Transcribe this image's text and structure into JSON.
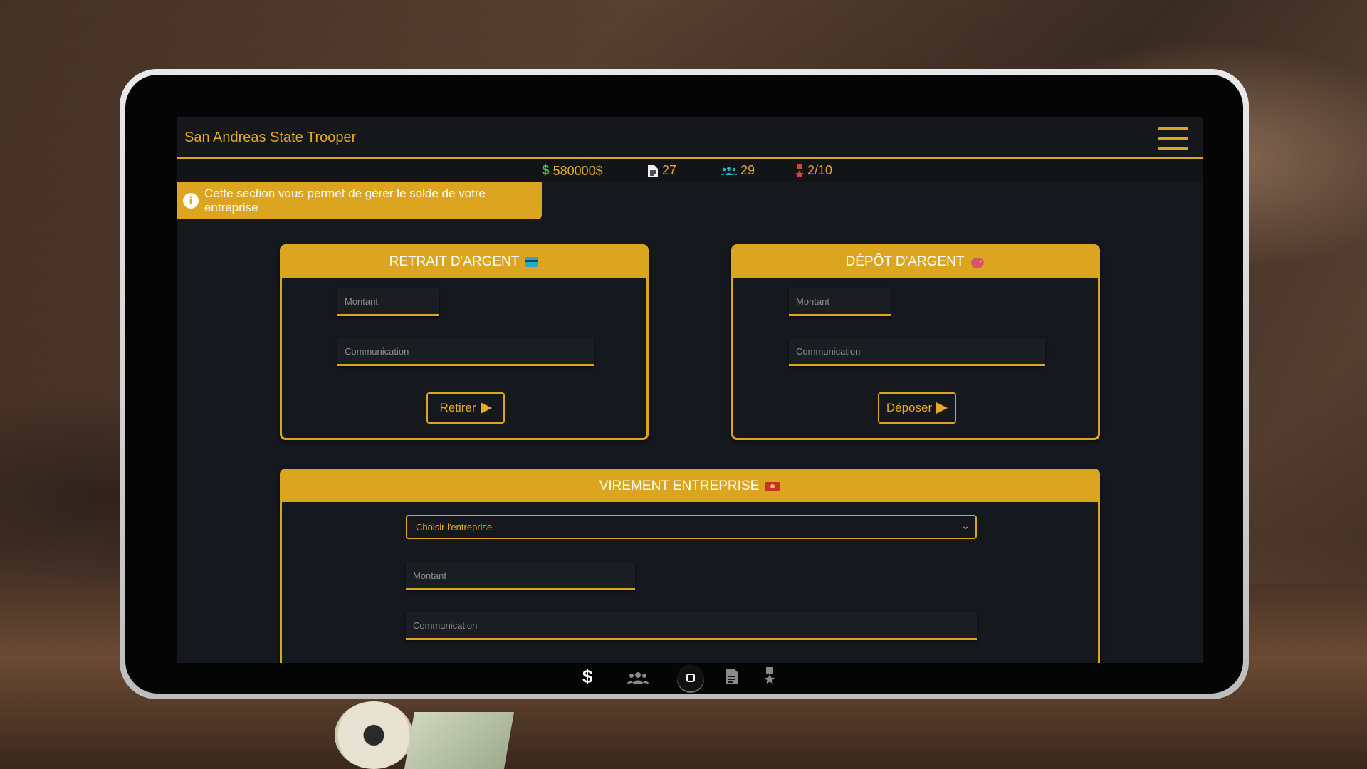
{
  "app": {
    "title": "San Andreas State Trooper"
  },
  "stats": {
    "money": "580000$",
    "documents": "27",
    "members": "29",
    "rank": "2/10"
  },
  "info": {
    "message": "Cette section vous permet de gérer le solde de votre entreprise"
  },
  "withdraw": {
    "title": "RETRAIT D'ARGENT",
    "amount_placeholder": "Montant",
    "comment_placeholder": "Communication",
    "button_label": "Retirer"
  },
  "deposit": {
    "title": "DÉPÔT D'ARGENT",
    "amount_placeholder": "Montant",
    "comment_placeholder": "Communication",
    "button_label": "Déposer"
  },
  "transfer": {
    "title": "VIREMENT ENTREPRISE",
    "select_label": "Choisir l'entreprise",
    "amount_placeholder": "Montant",
    "comment_placeholder": "Communication"
  },
  "icons": {
    "dollar": "dollar-icon",
    "document": "document-icon",
    "users": "users-icon",
    "medal": "medal-icon",
    "credit_card": "credit-card-icon",
    "piggy_bank": "piggy-bank-icon",
    "money_bill": "money-bill-icon"
  },
  "colors": {
    "accent": "#dba520",
    "background": "#15181c",
    "money_green": "#3fbf3f",
    "users_teal": "#22b5c9",
    "medal_red": "#d9452f"
  }
}
